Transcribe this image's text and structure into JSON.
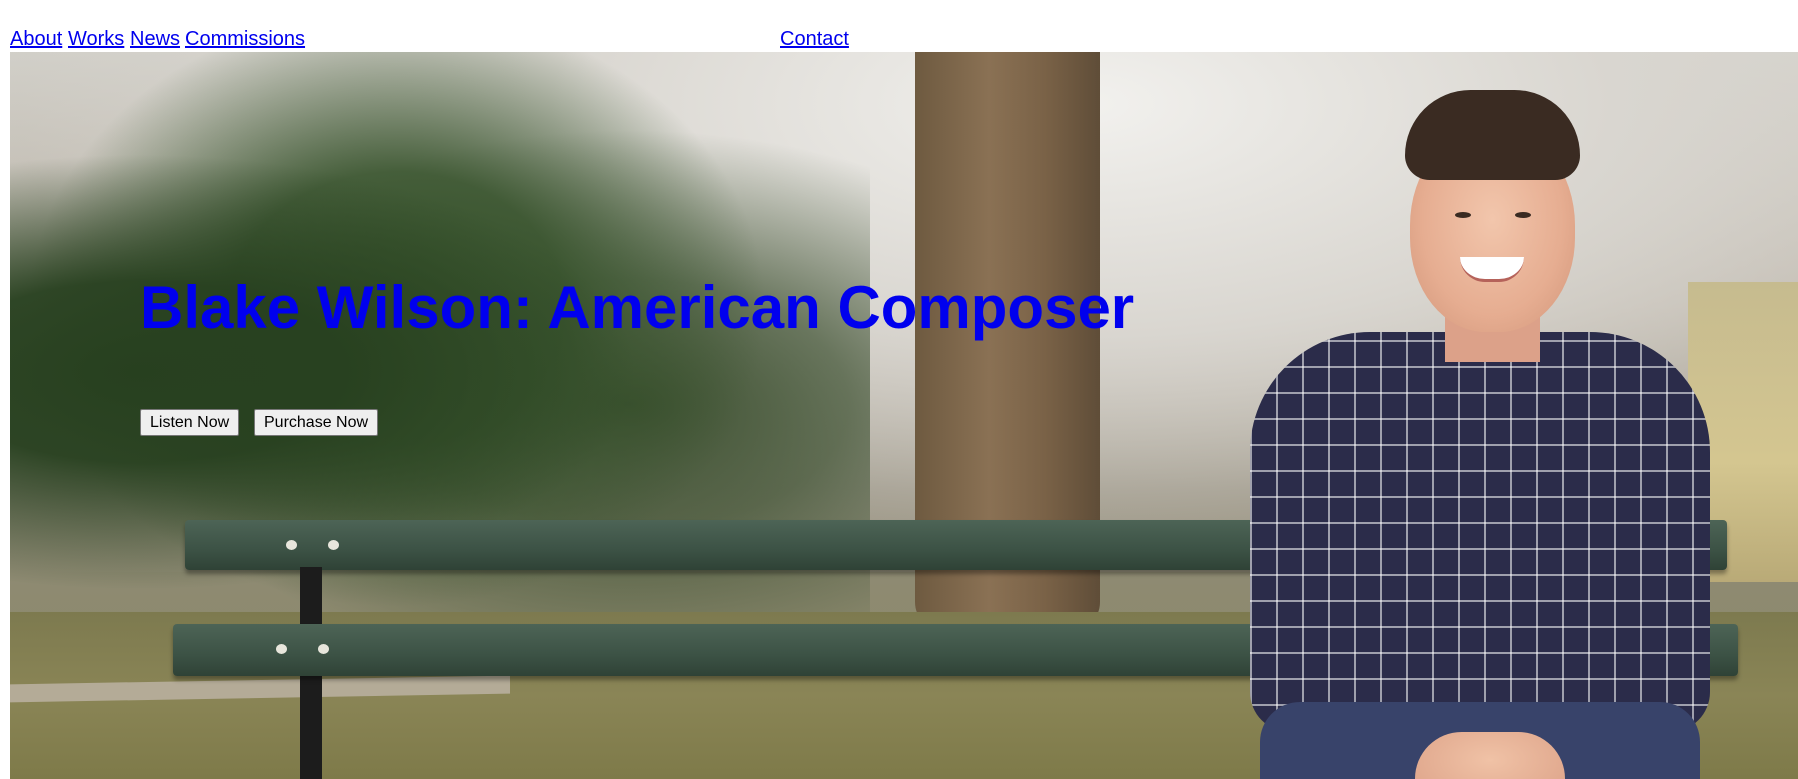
{
  "nav": {
    "about": "About",
    "works": "Works",
    "news": "News",
    "commissions": "Commissions",
    "contact": " Contact"
  },
  "hero": {
    "title": "Blake Wilson: American Composer",
    "buttons": {
      "listen": "Listen Now",
      "purchase": "Purchase Now"
    },
    "image": {
      "depiction": "photo-of-composer-on-park-bench"
    }
  },
  "colors": {
    "link": "#0000ee",
    "button_bg": "#efefef",
    "button_border": "#767676"
  }
}
